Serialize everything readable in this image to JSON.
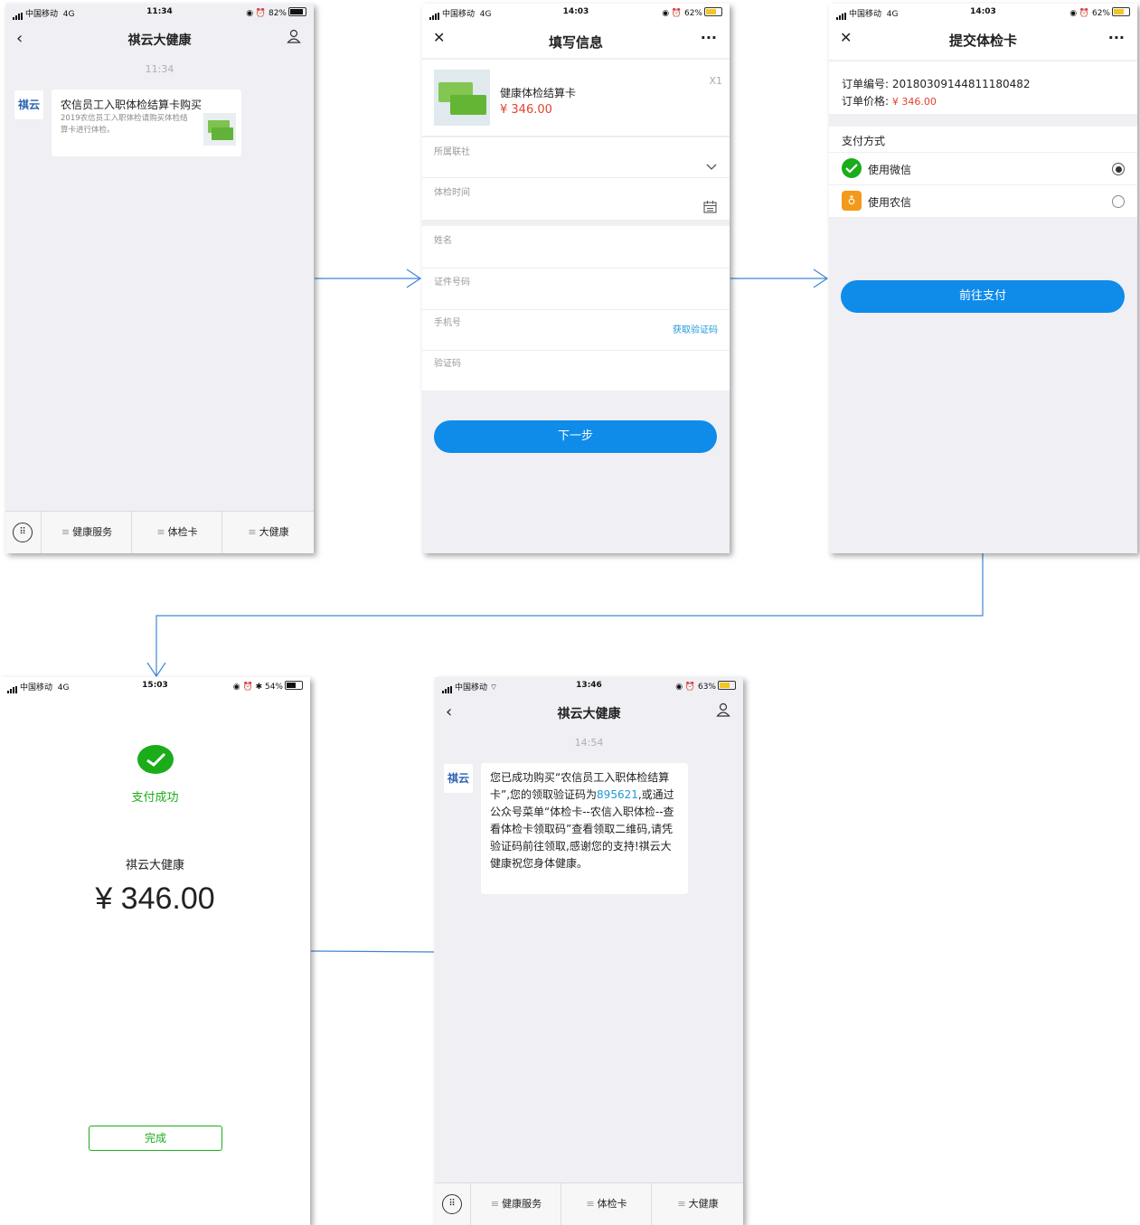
{
  "colors": {
    "accent": "#0f8bea",
    "price": "#e0432e",
    "success": "#1aad19",
    "link": "#1d9ad6"
  },
  "screen1": {
    "status": {
      "carrier": "中国移动",
      "network": "4G",
      "time": "11:34",
      "battery": "82%"
    },
    "title": "祺云大健康",
    "time_tag": "11:34",
    "avatar_text": "祺云",
    "card": {
      "title": "农信员工入职体检结算卡购买",
      "desc": "2019农信员工入职体检请购买体检结算卡进行体检。"
    },
    "tabs": [
      "健康服务",
      "体检卡",
      "大健康"
    ]
  },
  "screen2": {
    "status": {
      "carrier": "中国移动",
      "network": "4G",
      "time": "14:03",
      "battery": "62%"
    },
    "title": "填写信息",
    "more": "···",
    "product": {
      "name": "健康体检结算卡",
      "price": "¥ 346.00",
      "qty": "X1"
    },
    "fields": {
      "branch": "所属联社",
      "exam_time": "体检时间",
      "name": "姓名",
      "id_no": "证件号码",
      "phone": "手机号",
      "get_code": "获取验证码",
      "code": "验证码"
    },
    "next_button": "下一步"
  },
  "screen3": {
    "status": {
      "carrier": "中国移动",
      "network": "4G",
      "time": "14:03",
      "battery": "62%"
    },
    "title": "提交体检卡",
    "more": "···",
    "order_no_label": "订单编号:",
    "order_no": "20180309144811180482",
    "order_price_label": "订单价格:",
    "order_price": "¥ 346.00",
    "pay_method_label": "支付方式",
    "options": [
      "使用微信",
      "使用农信"
    ],
    "pay_button": "前往支付"
  },
  "screen4": {
    "status": {
      "carrier": "中国移动",
      "network": "4G",
      "time": "15:03",
      "battery": "54%"
    },
    "success_text": "支付成功",
    "merchant": "祺云大健康",
    "amount": "¥ 346.00",
    "done_button": "完成"
  },
  "screen5": {
    "status": {
      "carrier": "中国移动",
      "time": "13:46",
      "battery": "63%"
    },
    "title": "祺云大健康",
    "time_tag": "14:54",
    "avatar_text": "祺云",
    "msg_part1": "您已成功购买“农信员工入职体检结算卡”,您的领取验证码为",
    "code": "895621",
    "msg_part2": ",或通过公众号菜单“体检卡--农信入职体检--查看体检卡领取码”查看领取二维码,请凭验证码前往领取,感谢您的支持!祺云大健康祝您身体健康。",
    "tabs": [
      "健康服务",
      "体检卡",
      "大健康"
    ]
  }
}
